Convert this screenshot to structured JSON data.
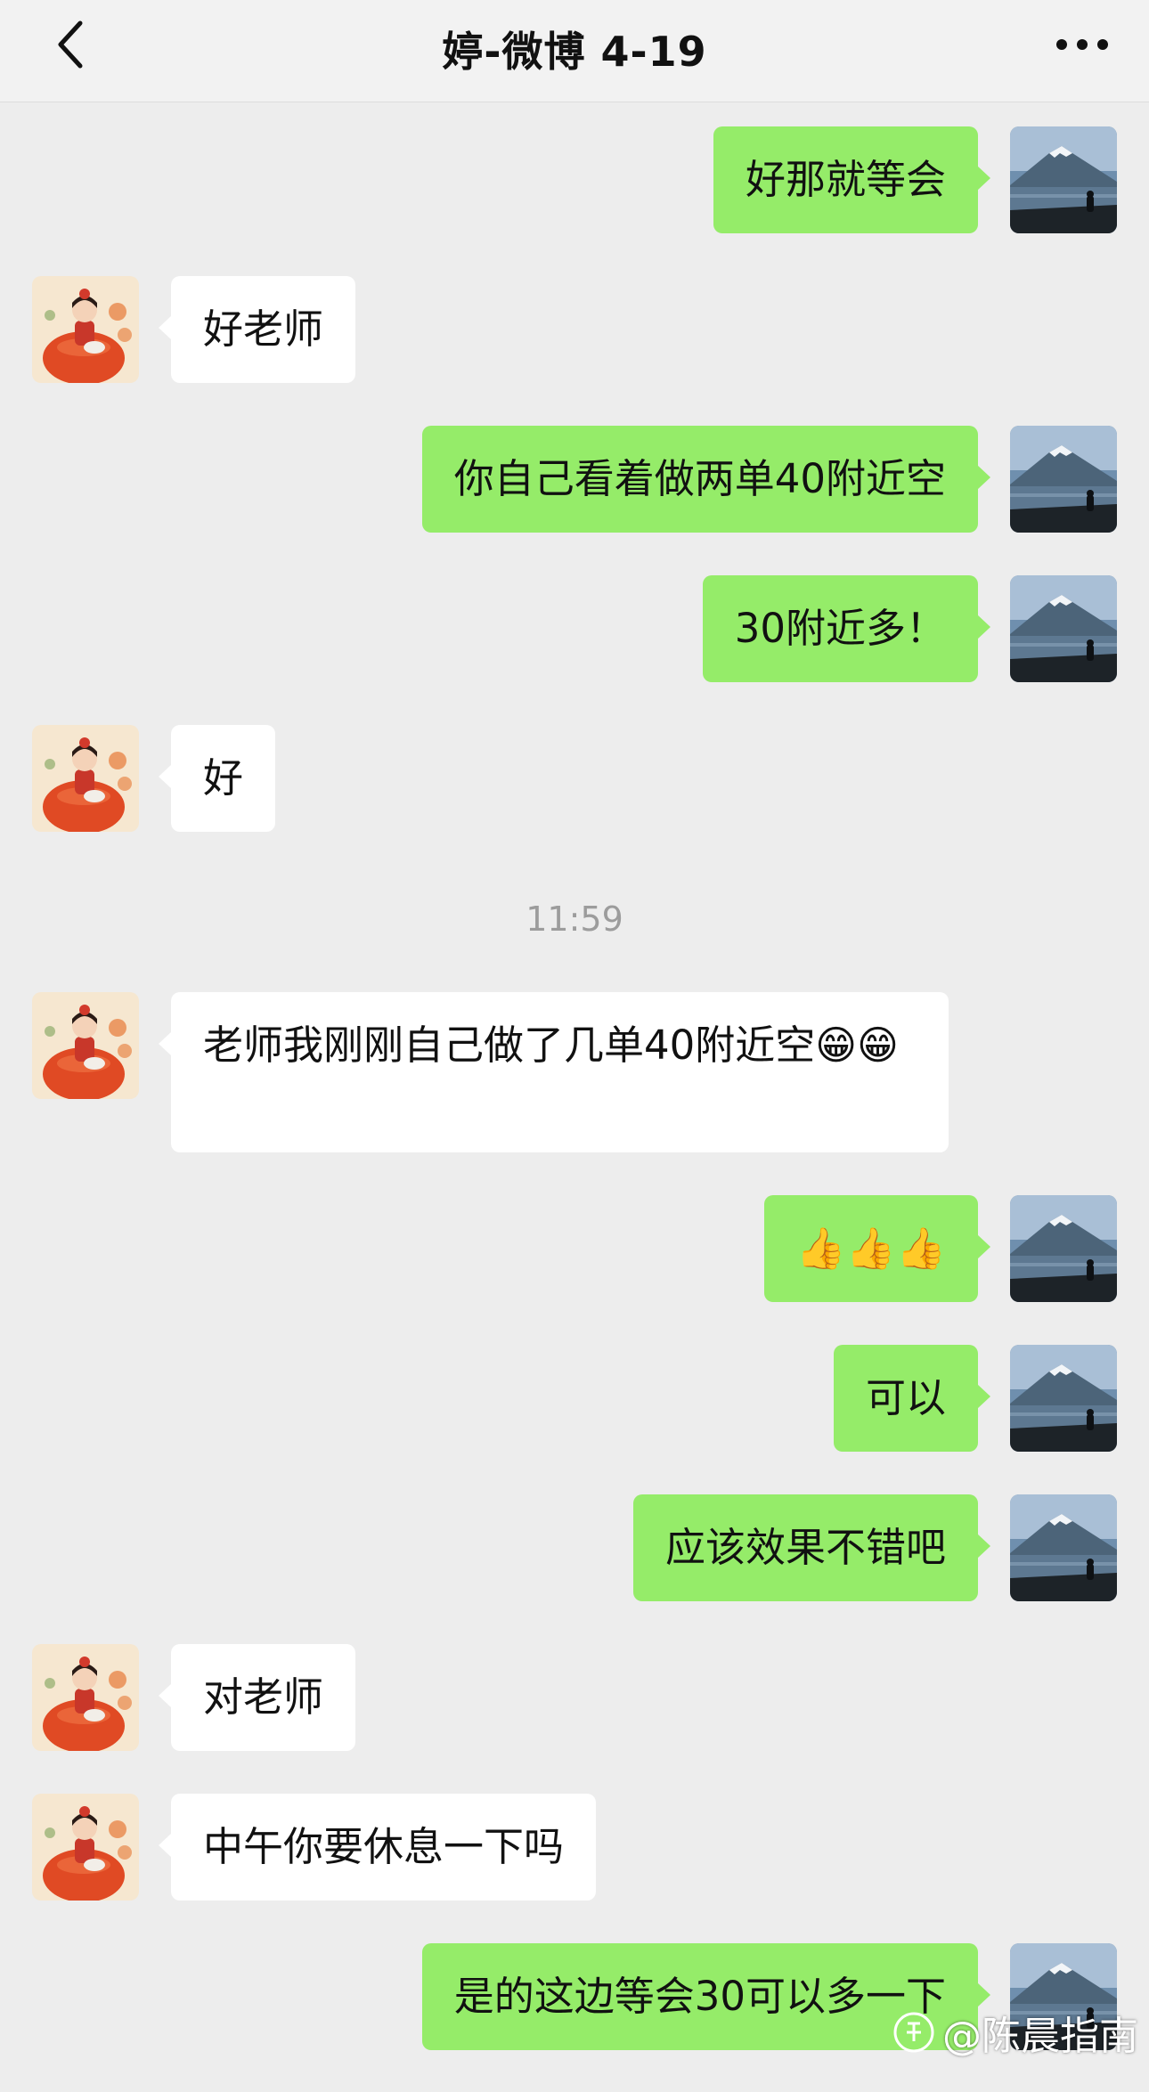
{
  "header": {
    "title": "婷-微博 4-19",
    "back_icon": "chevron-left-icon",
    "more_icon": "more-dots-icon"
  },
  "colors": {
    "outgoing_bubble": "#95ec69",
    "incoming_bubble": "#ffffff",
    "background": "#ededed"
  },
  "messages": [
    {
      "side": "out",
      "text": "好那就等会"
    },
    {
      "side": "in",
      "text": "好老师"
    },
    {
      "side": "out",
      "text": "你自己看着做两单40附近空"
    },
    {
      "side": "out",
      "text": "30附近多！"
    },
    {
      "side": "in",
      "text": "好"
    },
    {
      "type": "time",
      "text": "11:59"
    },
    {
      "side": "in",
      "text": "老师我刚刚自己做了几单40附近空😁😁"
    },
    {
      "side": "out",
      "text": "👍👍👍"
    },
    {
      "side": "out",
      "text": "可以"
    },
    {
      "side": "out",
      "text": "应该效果不错吧"
    },
    {
      "side": "in",
      "text": "对老师"
    },
    {
      "side": "in",
      "text": "中午你要休息一下吗"
    },
    {
      "side": "out",
      "text": "是的这边等会30可以多一下"
    }
  ],
  "watermark": {
    "text": "@陈晨指南",
    "logo_icon": "zhihu-logo-icon"
  }
}
